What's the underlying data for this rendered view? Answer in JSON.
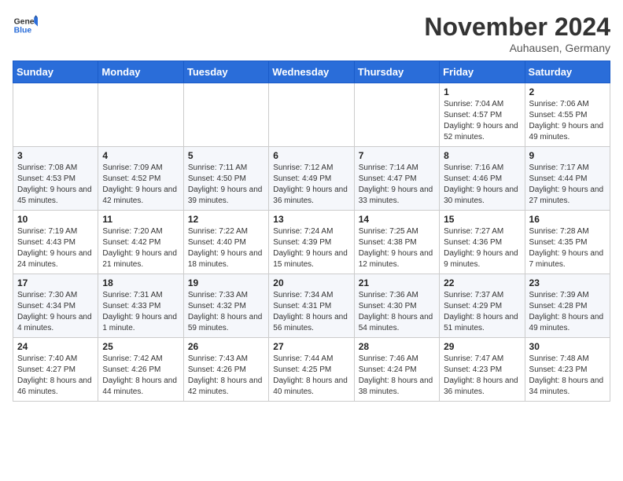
{
  "header": {
    "logo_general": "General",
    "logo_blue": "Blue",
    "month_title": "November 2024",
    "location": "Auhausen, Germany"
  },
  "weekdays": [
    "Sunday",
    "Monday",
    "Tuesday",
    "Wednesday",
    "Thursday",
    "Friday",
    "Saturday"
  ],
  "weeks": [
    [
      {
        "day": "",
        "info": ""
      },
      {
        "day": "",
        "info": ""
      },
      {
        "day": "",
        "info": ""
      },
      {
        "day": "",
        "info": ""
      },
      {
        "day": "",
        "info": ""
      },
      {
        "day": "1",
        "info": "Sunrise: 7:04 AM\nSunset: 4:57 PM\nDaylight: 9 hours and 52 minutes."
      },
      {
        "day": "2",
        "info": "Sunrise: 7:06 AM\nSunset: 4:55 PM\nDaylight: 9 hours and 49 minutes."
      }
    ],
    [
      {
        "day": "3",
        "info": "Sunrise: 7:08 AM\nSunset: 4:53 PM\nDaylight: 9 hours and 45 minutes."
      },
      {
        "day": "4",
        "info": "Sunrise: 7:09 AM\nSunset: 4:52 PM\nDaylight: 9 hours and 42 minutes."
      },
      {
        "day": "5",
        "info": "Sunrise: 7:11 AM\nSunset: 4:50 PM\nDaylight: 9 hours and 39 minutes."
      },
      {
        "day": "6",
        "info": "Sunrise: 7:12 AM\nSunset: 4:49 PM\nDaylight: 9 hours and 36 minutes."
      },
      {
        "day": "7",
        "info": "Sunrise: 7:14 AM\nSunset: 4:47 PM\nDaylight: 9 hours and 33 minutes."
      },
      {
        "day": "8",
        "info": "Sunrise: 7:16 AM\nSunset: 4:46 PM\nDaylight: 9 hours and 30 minutes."
      },
      {
        "day": "9",
        "info": "Sunrise: 7:17 AM\nSunset: 4:44 PM\nDaylight: 9 hours and 27 minutes."
      }
    ],
    [
      {
        "day": "10",
        "info": "Sunrise: 7:19 AM\nSunset: 4:43 PM\nDaylight: 9 hours and 24 minutes."
      },
      {
        "day": "11",
        "info": "Sunrise: 7:20 AM\nSunset: 4:42 PM\nDaylight: 9 hours and 21 minutes."
      },
      {
        "day": "12",
        "info": "Sunrise: 7:22 AM\nSunset: 4:40 PM\nDaylight: 9 hours and 18 minutes."
      },
      {
        "day": "13",
        "info": "Sunrise: 7:24 AM\nSunset: 4:39 PM\nDaylight: 9 hours and 15 minutes."
      },
      {
        "day": "14",
        "info": "Sunrise: 7:25 AM\nSunset: 4:38 PM\nDaylight: 9 hours and 12 minutes."
      },
      {
        "day": "15",
        "info": "Sunrise: 7:27 AM\nSunset: 4:36 PM\nDaylight: 9 hours and 9 minutes."
      },
      {
        "day": "16",
        "info": "Sunrise: 7:28 AM\nSunset: 4:35 PM\nDaylight: 9 hours and 7 minutes."
      }
    ],
    [
      {
        "day": "17",
        "info": "Sunrise: 7:30 AM\nSunset: 4:34 PM\nDaylight: 9 hours and 4 minutes."
      },
      {
        "day": "18",
        "info": "Sunrise: 7:31 AM\nSunset: 4:33 PM\nDaylight: 9 hours and 1 minute."
      },
      {
        "day": "19",
        "info": "Sunrise: 7:33 AM\nSunset: 4:32 PM\nDaylight: 8 hours and 59 minutes."
      },
      {
        "day": "20",
        "info": "Sunrise: 7:34 AM\nSunset: 4:31 PM\nDaylight: 8 hours and 56 minutes."
      },
      {
        "day": "21",
        "info": "Sunrise: 7:36 AM\nSunset: 4:30 PM\nDaylight: 8 hours and 54 minutes."
      },
      {
        "day": "22",
        "info": "Sunrise: 7:37 AM\nSunset: 4:29 PM\nDaylight: 8 hours and 51 minutes."
      },
      {
        "day": "23",
        "info": "Sunrise: 7:39 AM\nSunset: 4:28 PM\nDaylight: 8 hours and 49 minutes."
      }
    ],
    [
      {
        "day": "24",
        "info": "Sunrise: 7:40 AM\nSunset: 4:27 PM\nDaylight: 8 hours and 46 minutes."
      },
      {
        "day": "25",
        "info": "Sunrise: 7:42 AM\nSunset: 4:26 PM\nDaylight: 8 hours and 44 minutes."
      },
      {
        "day": "26",
        "info": "Sunrise: 7:43 AM\nSunset: 4:26 PM\nDaylight: 8 hours and 42 minutes."
      },
      {
        "day": "27",
        "info": "Sunrise: 7:44 AM\nSunset: 4:25 PM\nDaylight: 8 hours and 40 minutes."
      },
      {
        "day": "28",
        "info": "Sunrise: 7:46 AM\nSunset: 4:24 PM\nDaylight: 8 hours and 38 minutes."
      },
      {
        "day": "29",
        "info": "Sunrise: 7:47 AM\nSunset: 4:23 PM\nDaylight: 8 hours and 36 minutes."
      },
      {
        "day": "30",
        "info": "Sunrise: 7:48 AM\nSunset: 4:23 PM\nDaylight: 8 hours and 34 minutes."
      }
    ]
  ]
}
